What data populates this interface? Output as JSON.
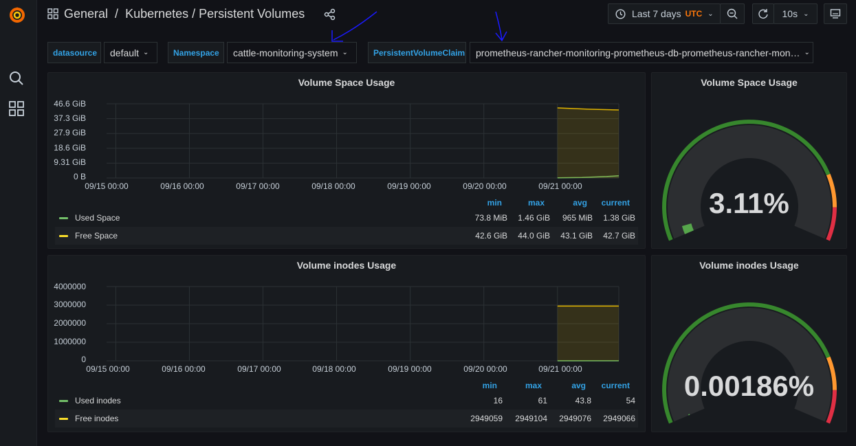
{
  "breadcrumb": {
    "folder": "General",
    "separator": "/",
    "dashboard": "Kubernetes / Persistent Volumes"
  },
  "toolbar": {
    "time_range": "Last 7 days",
    "timezone": "UTC",
    "refresh_interval": "10s"
  },
  "variables": {
    "datasource": {
      "label": "datasource",
      "value": "default"
    },
    "namespace": {
      "label": "Namespace",
      "value": "cattle-monitoring-system"
    },
    "pvc": {
      "label": "PersistentVolumeClaim",
      "value": "prometheus-rancher-monitoring-prometheus-db-prometheus-rancher-mon…"
    }
  },
  "legend_headers": [
    "min",
    "max",
    "avg",
    "current"
  ],
  "panels": {
    "space_graph": {
      "title": "Volume Space Usage",
      "y_ticks": [
        "46.6 GiB",
        "37.3 GiB",
        "27.9 GiB",
        "18.6 GiB",
        "9.31 GiB",
        "0 B"
      ],
      "x_ticks": [
        "09/15 00:00",
        "09/16 00:00",
        "09/17 00:00",
        "09/18 00:00",
        "09/19 00:00",
        "09/20 00:00",
        "09/21 00:00"
      ],
      "legend": [
        {
          "name": "Used Space",
          "min": "73.8 MiB",
          "max": "1.46 GiB",
          "avg": "965 MiB",
          "current": "1.38 GiB"
        },
        {
          "name": "Free Space",
          "min": "42.6 GiB",
          "max": "44.0 GiB",
          "avg": "43.1 GiB",
          "current": "42.7 GiB"
        }
      ]
    },
    "space_gauge": {
      "title": "Volume Space Usage",
      "value_text": "3.11%",
      "value": 3.11
    },
    "inodes_graph": {
      "title": "Volume inodes Usage",
      "y_ticks": [
        "4000000",
        "3000000",
        "2000000",
        "1000000",
        "0"
      ],
      "x_ticks": [
        "09/15 00:00",
        "09/16 00:00",
        "09/17 00:00",
        "09/18 00:00",
        "09/19 00:00",
        "09/20 00:00",
        "09/21 00:00"
      ],
      "legend": [
        {
          "name": "Used inodes",
          "min": "16",
          "max": "61",
          "avg": "43.8",
          "current": "54"
        },
        {
          "name": "Free inodes",
          "min": "2949059",
          "max": "2949104",
          "avg": "2949076",
          "current": "2949066"
        }
      ]
    },
    "inodes_gauge": {
      "title": "Volume inodes Usage",
      "value_text": "0.00186%",
      "value": 0.00186
    }
  },
  "chart_data": [
    {
      "type": "line",
      "title": "Volume Space Usage",
      "ylim": [
        0,
        46.6
      ],
      "x_range": [
        "09/14 ~21:00",
        "09/21 ~20:00"
      ],
      "series": [
        {
          "name": "Used Space",
          "unit": "GiB",
          "points": [
            [
              "09/21 00:00",
              0.07
            ],
            [
              "09/21 08:00",
              0.3
            ],
            [
              "09/21 16:00",
              0.9
            ],
            [
              "09/21 20:00",
              1.38
            ]
          ]
        },
        {
          "name": "Free Space",
          "unit": "GiB",
          "points": [
            [
              "09/21 00:00",
              44.0
            ],
            [
              "09/21 10:00",
              43.2
            ],
            [
              "09/21 20:00",
              42.7
            ]
          ]
        }
      ]
    },
    {
      "type": "line",
      "title": "Volume inodes Usage",
      "ylim": [
        0,
        4000000
      ],
      "x_range": [
        "09/14 ~21:00",
        "09/21 ~20:00"
      ],
      "series": [
        {
          "name": "Used inodes",
          "points": [
            [
              "09/21 00:00",
              16
            ],
            [
              "09/21 20:00",
              54
            ]
          ]
        },
        {
          "name": "Free inodes",
          "points": [
            [
              "09/21 00:00",
              2949104
            ],
            [
              "09/21 20:00",
              2949066
            ]
          ]
        }
      ]
    }
  ],
  "colors": {
    "green": "#37872d",
    "yellow": "#e0b400",
    "orange": "#f2cc0c",
    "red": "#e02f44",
    "blue": "#33a2e5",
    "gauge_green": "#56a64b",
    "gauge_orange": "#ff9830",
    "gauge_red": "#f2495c"
  }
}
